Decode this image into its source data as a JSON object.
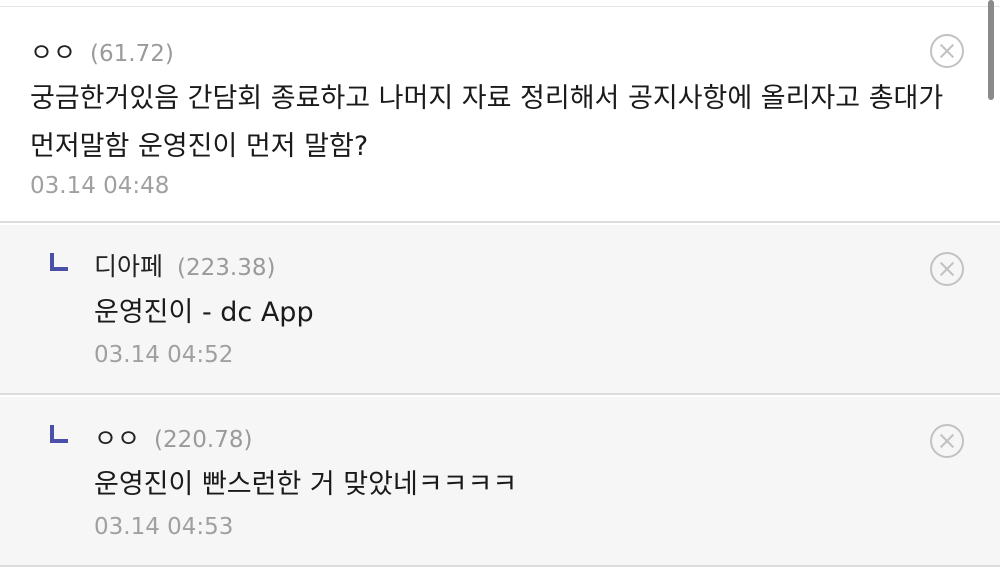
{
  "comments": [
    {
      "nickname": "ㅇㅇ",
      "ip": "(61.72)",
      "text": "궁금한거있음 간담회 종료하고 나머지 자료 정리해서 공지사항에 올리자고 총대가 먼저말함 운영진이 먼저 말함?",
      "date": "03.14 04:48",
      "delete_icon": "close-circle-icon"
    },
    {
      "nickname": "디아페",
      "ip": "(223.38)",
      "text": "운영진이 - dc App",
      "date": "03.14 04:52",
      "reply_icon": "reply-arrow-icon",
      "delete_icon": "close-circle-icon"
    },
    {
      "nickname": "ㅇㅇ",
      "ip": "(220.78)",
      "text": "운영진이 빤스런한 거 맞았네ㅋㅋㅋㅋ",
      "date": "03.14 04:53",
      "reply_icon": "reply-arrow-icon",
      "delete_icon": "close-circle-icon"
    }
  ],
  "colors": {
    "reply_background": "#f6f6f7",
    "reply_arrow": "#4a4fa8",
    "meta_gray": "#9a9a9a",
    "divider": "#dcdcdc"
  }
}
